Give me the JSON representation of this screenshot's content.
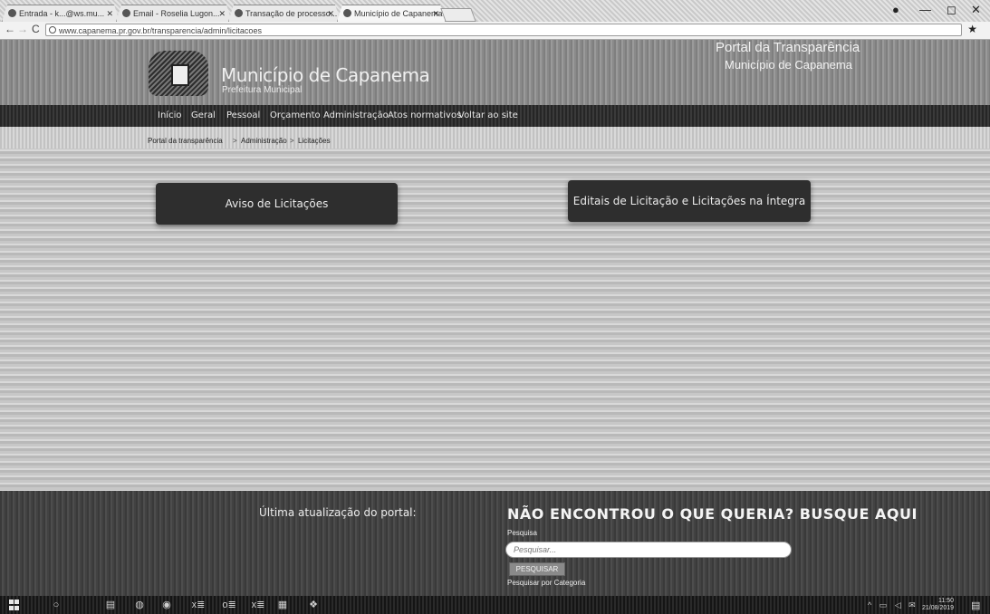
{
  "browser": {
    "tabs": [
      {
        "title": "Entrada - k...@ws.mu..."
      },
      {
        "title": "Email - Roselia Lugon..."
      },
      {
        "title": "Transação de processo..."
      },
      {
        "title": "Município de Capanema"
      }
    ],
    "url": "www.capanema.pr.gov.br/transparencia/admin/licitacoes",
    "window_controls": {
      "account": "●",
      "minimize": "—",
      "maximize": "◻",
      "close": "✕"
    },
    "nav": {
      "back": "←",
      "forward": "→",
      "reload": "C"
    }
  },
  "header": {
    "municipio_name": "Município de Capanema",
    "municipio_sub": "Prefeitura Municipal",
    "portal_title": "Portal da Transparência",
    "portal_municipio": "Município de Capanema"
  },
  "nav": {
    "items": [
      {
        "label": "Início"
      },
      {
        "label": "Geral"
      },
      {
        "label": "Pessoal"
      },
      {
        "label": "Orçamento"
      },
      {
        "label": "Administração"
      },
      {
        "label": "Atos normativos"
      },
      {
        "label": "Voltar ao site"
      }
    ]
  },
  "breadcrumb": {
    "items": [
      "Portal da transparência",
      "Administração",
      "Licitações"
    ],
    "separator": ">"
  },
  "cards": {
    "aviso": "Aviso de Licitações",
    "editais": "Editais de Licitação e Licitações na Íntegra"
  },
  "footer": {
    "last_update": "Última atualização do portal:",
    "search_heading": "NÃO ENCONTROU O QUE QUERIA? BUSQUE AQUI",
    "search_label": "Pesquisa",
    "search_placeholder": "Pesquisar...",
    "search_button": "PESQUISAR",
    "search_by_category": "Pesquisar por Categoria"
  },
  "taskbar": {
    "search_glyph": "○",
    "app_glyphs": [
      "▤",
      "◍",
      "◉",
      "x≣",
      "o≣",
      "x≣",
      "▦",
      "❖"
    ],
    "tray": "^ ▭ ◁ ✉",
    "time": "11:50",
    "date": "21/08/2019"
  },
  "colors": {
    "header_bg": "#8a8a8a",
    "nav_bg": "#2f2f2f",
    "card_bg": "#2e2e2e",
    "footer_bg": "#444444"
  }
}
